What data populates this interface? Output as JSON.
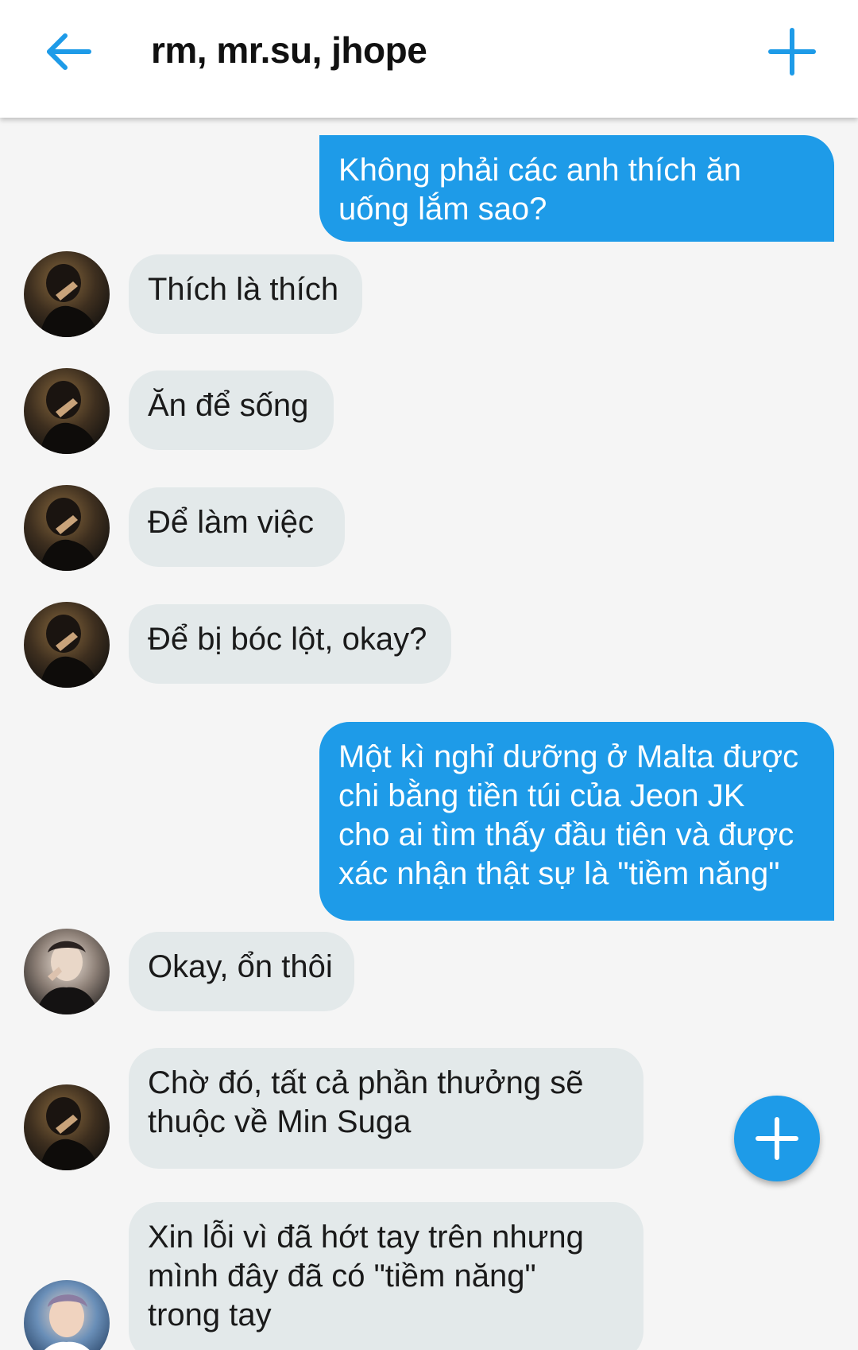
{
  "header": {
    "title": "rm, mr.su, jhope",
    "back_icon": "arrow-left-icon",
    "add_icon": "plus-icon"
  },
  "colors": {
    "accent": "#1e9be8",
    "incoming_bubble": "#e3e9ea",
    "background": "#f5f5f5"
  },
  "messages": [
    {
      "direction": "out",
      "lines": [
        "Không phải các anh thích ăn",
        "uống lắm sao?"
      ]
    },
    {
      "direction": "in",
      "sender_avatar": "mr.su-avatar",
      "lines": [
        "Thích là thích"
      ]
    },
    {
      "direction": "in",
      "sender_avatar": "mr.su-avatar",
      "lines": [
        "Ăn để sống"
      ]
    },
    {
      "direction": "in",
      "sender_avatar": "mr.su-avatar",
      "lines": [
        "Để làm việc"
      ]
    },
    {
      "direction": "in",
      "sender_avatar": "mr.su-avatar",
      "lines": [
        "Để bị bóc lột, okay?"
      ]
    },
    {
      "direction": "out",
      "lines": [
        "Một kì nghỉ dưỡng ở Malta được",
        "chi bằng tiền túi của Jeon JK",
        "cho ai tìm thấy đầu tiên và được",
        "xác nhận thật sự là \"tiềm năng\""
      ]
    },
    {
      "direction": "in",
      "sender_avatar": "jhope-avatar",
      "lines": [
        "Okay, ổn thôi"
      ]
    },
    {
      "direction": "in",
      "sender_avatar": "mr.su-avatar",
      "lines": [
        "Chờ đó, tất cả phần thưởng sẽ",
        "thuộc về Min Suga"
      ]
    },
    {
      "direction": "in",
      "sender_avatar": "rm-avatar",
      "lines": [
        "Xin lỗi vì đã hớt tay trên nhưng",
        "mình đây đã có \"tiềm năng\"",
        "trong tay"
      ]
    }
  ],
  "fab": {
    "icon": "plus-icon"
  }
}
